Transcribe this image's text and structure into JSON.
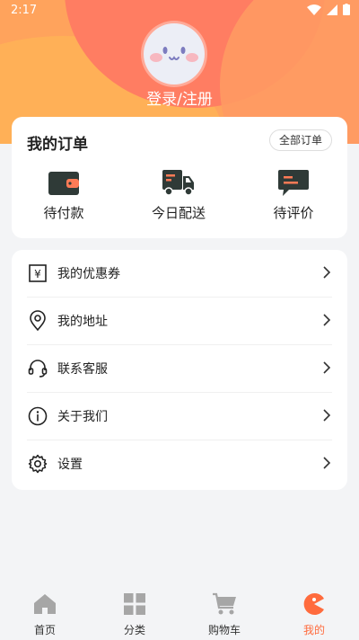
{
  "status_bar": {
    "time": "2:17"
  },
  "profile": {
    "login_label": "登录/注册"
  },
  "orders": {
    "title": "我的订单",
    "all_label": "全部订单",
    "items": [
      {
        "label": "待付款",
        "icon": "wallet-icon"
      },
      {
        "label": "今日配送",
        "icon": "delivery-truck-icon"
      },
      {
        "label": "待评价",
        "icon": "comment-icon"
      }
    ]
  },
  "menu": {
    "items": [
      {
        "label": "我的优惠券",
        "icon": "coupon-icon"
      },
      {
        "label": "我的地址",
        "icon": "location-pin-icon"
      },
      {
        "label": "联系客服",
        "icon": "headset-icon"
      },
      {
        "label": "关于我们",
        "icon": "info-icon"
      },
      {
        "label": "设置",
        "icon": "gear-icon"
      }
    ]
  },
  "tabs": [
    {
      "label": "首页",
      "icon": "home-icon"
    },
    {
      "label": "分类",
      "icon": "category-grid-icon"
    },
    {
      "label": "购物车",
      "icon": "cart-icon"
    },
    {
      "label": "我的",
      "icon": "profile-face-icon",
      "active": true
    }
  ],
  "colors": {
    "accent": "#ff6b3d",
    "header_orange": "#ffa35c",
    "header_coral": "#ff7d62",
    "icon_dark": "#2f3a37",
    "icon_inactive": "#a6a6a6"
  }
}
